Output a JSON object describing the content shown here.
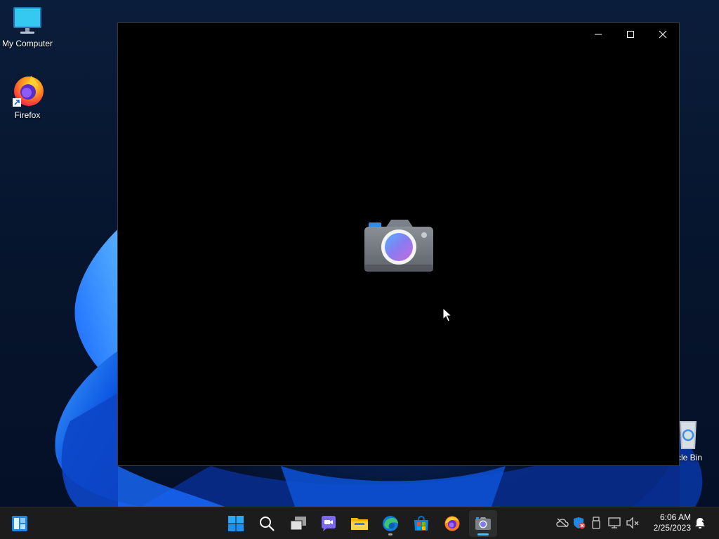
{
  "desktop": {
    "icons": [
      {
        "label": "My Computer",
        "icon": "monitor-icon"
      },
      {
        "label": "Firefox",
        "icon": "firefox-icon"
      },
      {
        "label": "rcle Bin",
        "icon": "recycle-bin-icon"
      }
    ]
  },
  "window": {
    "app": "Camera",
    "controls": [
      "minimize",
      "maximize",
      "close"
    ]
  },
  "taskbar": {
    "widgets_icon": "widgets-icon",
    "pinned": [
      {
        "name": "start",
        "icon": "windows-start-icon"
      },
      {
        "name": "search",
        "icon": "search-icon"
      },
      {
        "name": "task-view",
        "icon": "task-view-icon"
      },
      {
        "name": "chat",
        "icon": "chat-icon"
      },
      {
        "name": "file-explorer",
        "icon": "folder-icon"
      },
      {
        "name": "edge",
        "icon": "edge-icon"
      },
      {
        "name": "store",
        "icon": "store-icon"
      },
      {
        "name": "firefox",
        "icon": "firefox-icon"
      },
      {
        "name": "camera",
        "icon": "camera-icon",
        "active": true
      }
    ],
    "tray": [
      "onedrive-icon",
      "defender-icon",
      "usb-icon",
      "network-icon",
      "volume-muted-icon"
    ],
    "clock": {
      "time": "6:06 AM",
      "date": "2/25/2023"
    },
    "accent": "#4cc2ff"
  }
}
